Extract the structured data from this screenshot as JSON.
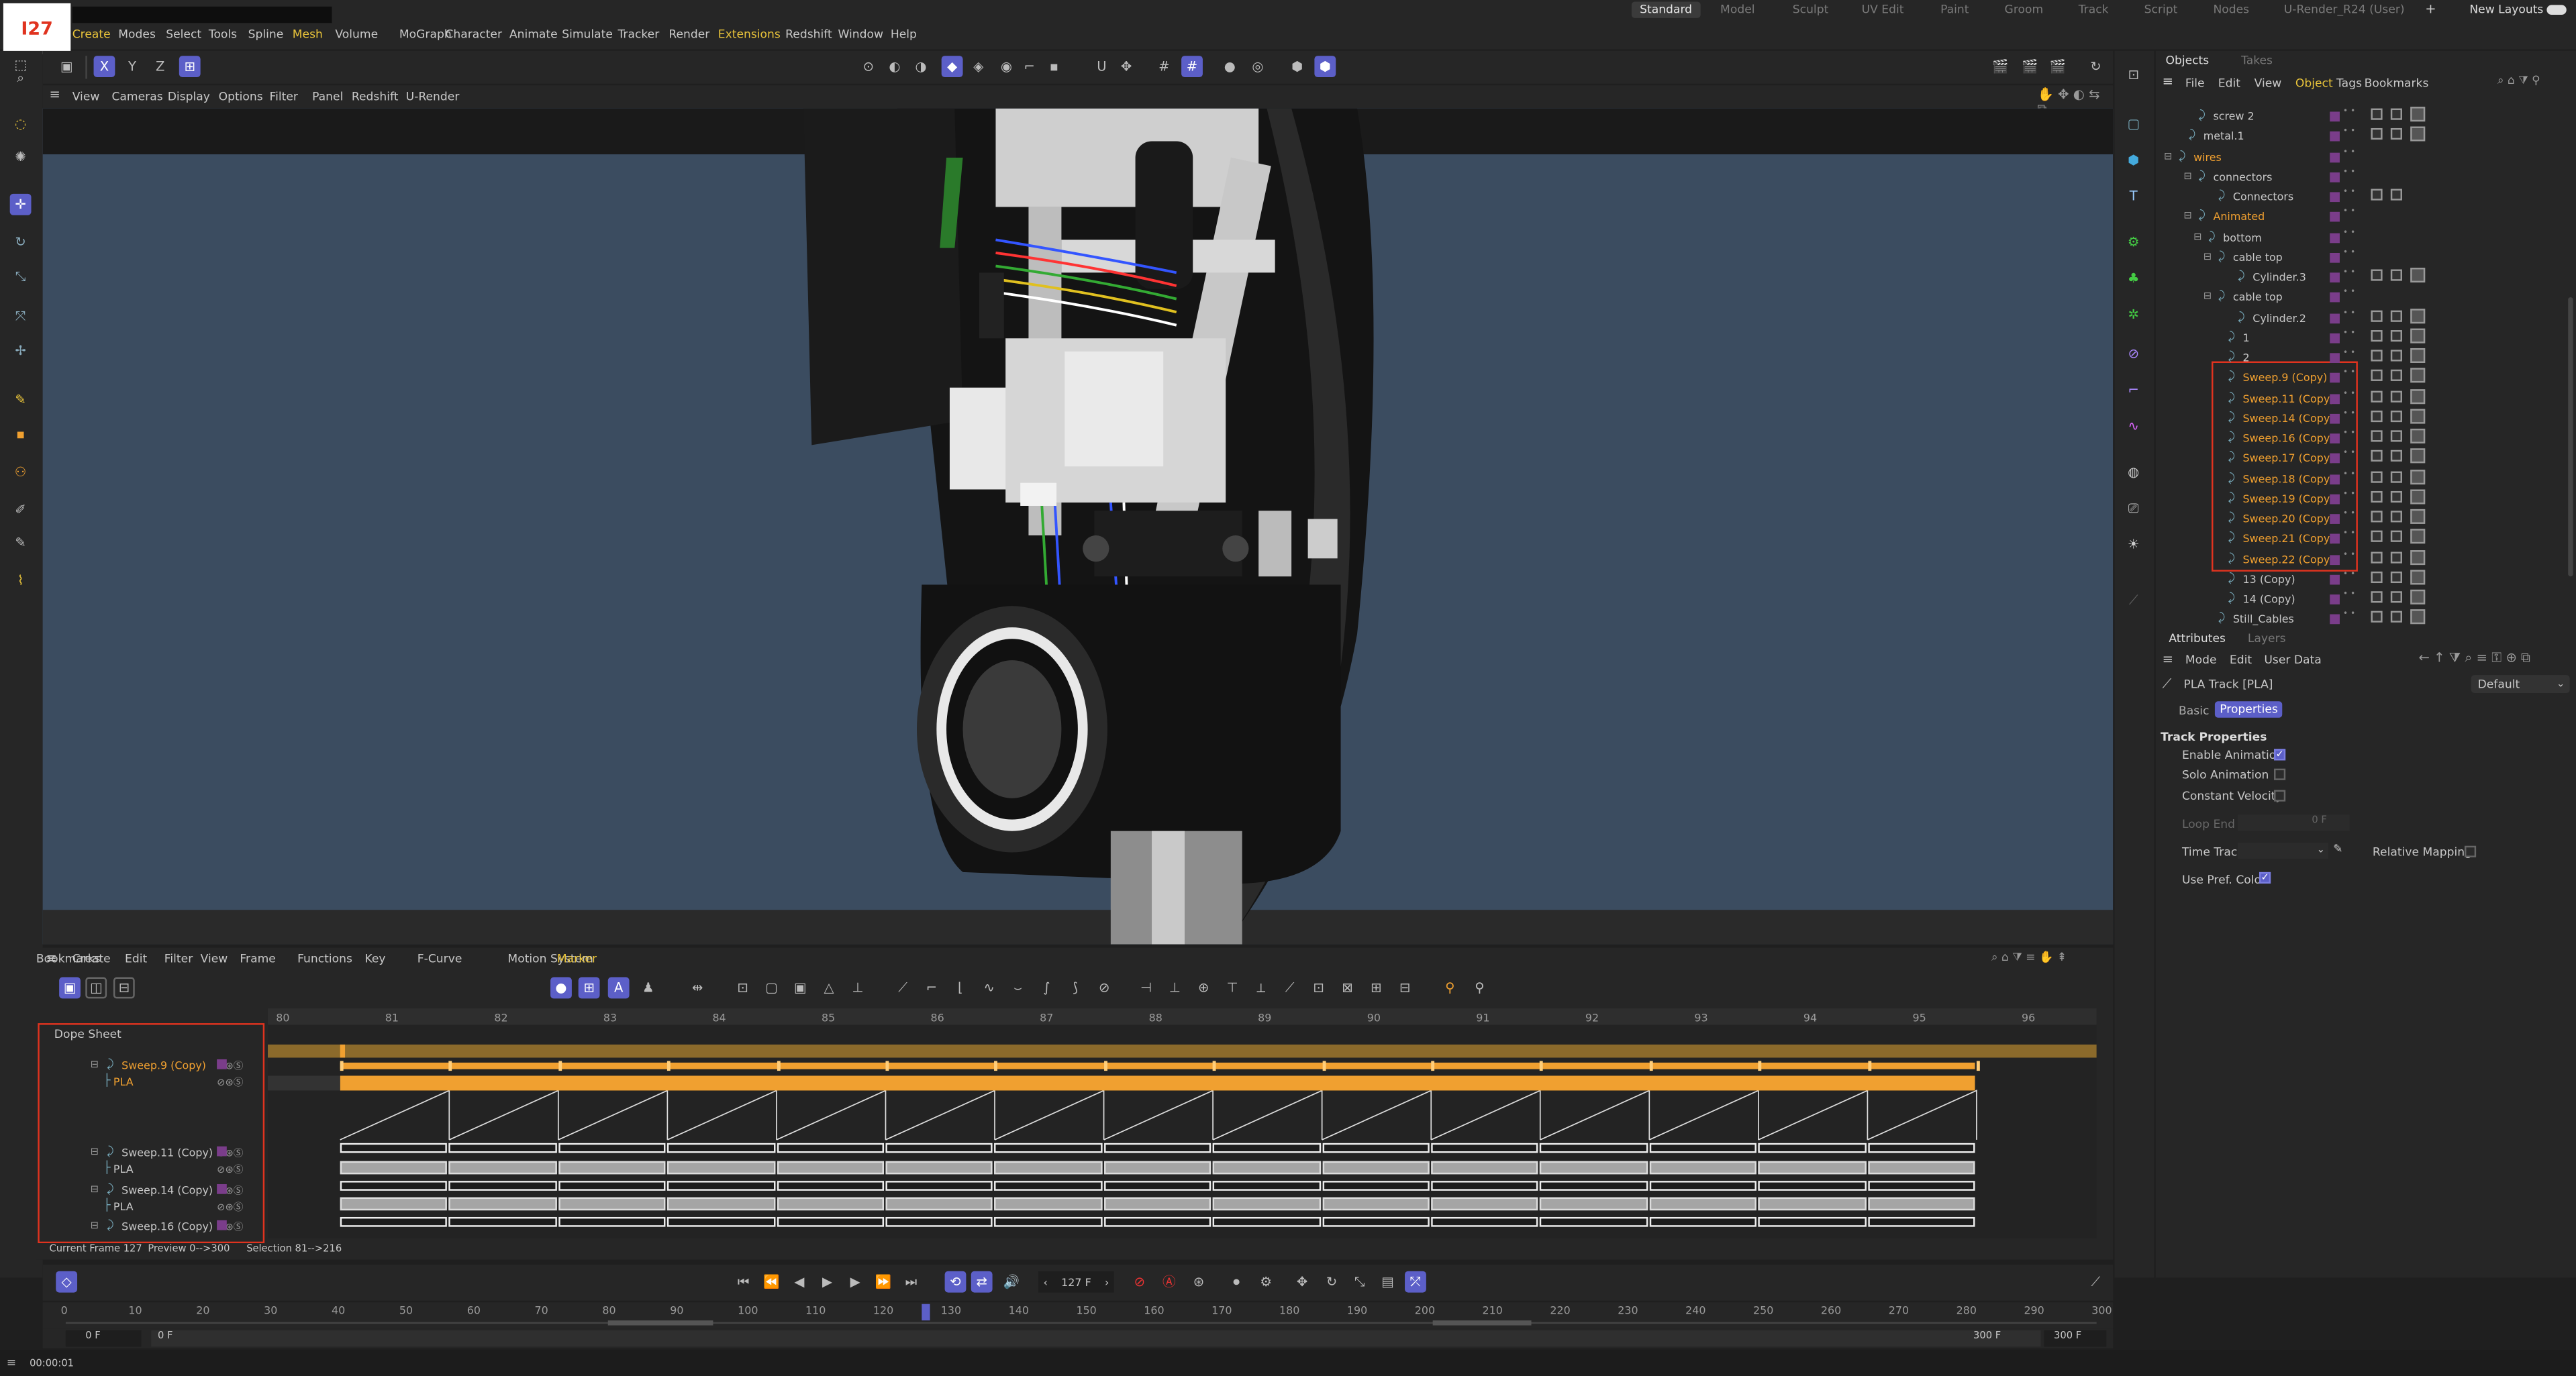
{
  "badge": "I27",
  "menu": [
    "Create",
    "Modes",
    "Select",
    "Tools",
    "Spline",
    "Mesh",
    "Volume",
    "MoGraph",
    "Character",
    "Animate",
    "Simulate",
    "Tracker",
    "Render",
    "Extensions",
    "Redshift",
    "Window",
    "Help"
  ],
  "layouts": {
    "active": "Standard",
    "items": [
      "Model",
      "Sculpt",
      "UV Edit",
      "Paint",
      "Groom",
      "Track",
      "Script",
      "Nodes",
      "U-Render_R24 (User)"
    ],
    "plus": "+",
    "new_layouts": "New Layouts"
  },
  "viewport_menu": [
    "View",
    "Cameras",
    "Display",
    "Options",
    "Filter",
    "Panel",
    "Redshift",
    "U-Render"
  ],
  "coord_buttons": [
    "X",
    "Y",
    "Z"
  ],
  "objects_panel": {
    "tabs": [
      "Objects",
      "Takes"
    ],
    "menu": [
      "File",
      "Edit",
      "View",
      "Object",
      "Tags",
      "Bookmarks"
    ],
    "rows": [
      {
        "name": "screw 2",
        "color": "#c8c8c8"
      },
      {
        "name": "metal.1",
        "color": "#c8c8c8"
      },
      {
        "name": "wires",
        "color": "#f0a030"
      },
      {
        "name": "connectors",
        "color": "#c8c8c8"
      },
      {
        "name": "Connectors",
        "color": "#c8c8c8"
      },
      {
        "name": "Animated",
        "color": "#f0a030"
      },
      {
        "name": "bottom",
        "color": "#c8c8c8"
      },
      {
        "name": "cable top",
        "color": "#c8c8c8"
      },
      {
        "name": "Cylinder.3",
        "color": "#c8c8c8"
      },
      {
        "name": "cable top",
        "color": "#c8c8c8"
      },
      {
        "name": "Cylinder.2",
        "color": "#c8c8c8"
      },
      {
        "name": "1",
        "color": "#c8c8c8"
      },
      {
        "name": "2",
        "color": "#c8c8c8"
      },
      {
        "name": "Sweep.9 (Copy)",
        "color": "#f0a030"
      },
      {
        "name": "Sweep.11 (Copy)",
        "color": "#f0a030"
      },
      {
        "name": "Sweep.14 (Copy)",
        "color": "#f0a030"
      },
      {
        "name": "Sweep.16 (Copy)",
        "color": "#f0a030"
      },
      {
        "name": "Sweep.17 (Copy)",
        "color": "#f0a030"
      },
      {
        "name": "Sweep.18 (Copy)",
        "color": "#f0a030"
      },
      {
        "name": "Sweep.19 (Copy)",
        "color": "#f0a030"
      },
      {
        "name": "Sweep.20 (Copy)",
        "color": "#f0a030"
      },
      {
        "name": "Sweep.21 (Copy)",
        "color": "#f0a030"
      },
      {
        "name": "Sweep.22 (Copy)",
        "color": "#f0a030"
      },
      {
        "name": "13 (Copy)",
        "color": "#c8c8c8"
      },
      {
        "name": "14 (Copy)",
        "color": "#c8c8c8"
      },
      {
        "name": "Still_Cables",
        "color": "#c8c8c8"
      }
    ]
  },
  "attributes": {
    "tabs": [
      "Attributes",
      "Layers"
    ],
    "menu": [
      "Mode",
      "Edit",
      "User Data"
    ],
    "track_title": "PLA Track [PLA]",
    "preset": "Default",
    "subtabs": [
      "Basic",
      "Properties"
    ],
    "section": "Track Properties",
    "enable_animation": "Enable Animation",
    "solo_animation": "Solo Animation",
    "constant_velocity": "Constant Velocity",
    "loop_end": "Loop End",
    "loop_end_value": "0 F",
    "time_track": "Time Track",
    "relative_mapping": "Relative Mapping",
    "use_pref_color": "Use Pref. Color"
  },
  "timeline_menu": [
    "Create",
    "Edit",
    "Filter",
    "View",
    "Frame",
    "Functions",
    "Key",
    "F-Curve",
    "Motion System",
    "Marker",
    "Bookmarks"
  ],
  "dope_sheet": {
    "title": "Dope Sheet",
    "ruler": [
      "80",
      "81",
      "82",
      "83",
      "84",
      "85",
      "86",
      "87",
      "88",
      "89",
      "90",
      "91",
      "92",
      "93",
      "94",
      "95",
      "96"
    ],
    "tracks": [
      {
        "name": "Sweep.9 (Copy)",
        "kind": "object"
      },
      {
        "name": "PLA",
        "kind": "track"
      },
      {
        "name": "Sweep.11 (Copy)",
        "kind": "object"
      },
      {
        "name": "PLA",
        "kind": "track"
      },
      {
        "name": "Sweep.14 (Copy)",
        "kind": "object"
      },
      {
        "name": "PLA",
        "kind": "track"
      },
      {
        "name": "Sweep.16 (Copy)",
        "kind": "object"
      }
    ]
  },
  "status_line": {
    "current_frame": "Current Frame  127",
    "preview": "Preview  0-->300",
    "selection": "Selection 81-->216"
  },
  "transport": {
    "frame": "127 F"
  },
  "scrubber": {
    "ticks": [
      "0",
      "10",
      "20",
      "30",
      "40",
      "50",
      "60",
      "70",
      "80",
      "90",
      "100",
      "110",
      "120",
      "130",
      "140",
      "150",
      "160",
      "170",
      "180",
      "190",
      "200",
      "210",
      "220",
      "230",
      "240",
      "250",
      "260",
      "270",
      "280",
      "290",
      "300"
    ],
    "start": "0 F",
    "min": "0 F",
    "max": "300 F",
    "end": "300 F",
    "current_value": 127
  },
  "bottom_status": {
    "time": "00:00:01"
  },
  "colors": {
    "accent": "#5c5fc8",
    "highlight_orange": "#f0a030",
    "annotation_red": "#e0331f",
    "menu_highlight": "#e8c33a"
  }
}
